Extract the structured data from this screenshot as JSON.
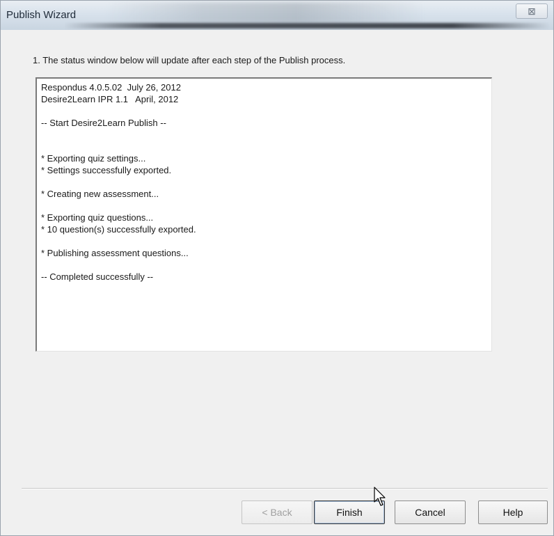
{
  "window": {
    "title": "Publish Wizard",
    "close_glyph": "⊠"
  },
  "instruction": "1.  The status window below will update after each step of the Publish process.",
  "status_lines": [
    "Respondus 4.0.5.02  July 26, 2012",
    "Desire2Learn IPR 1.1   April, 2012",
    "",
    "-- Start Desire2Learn Publish --",
    "",
    "",
    "* Exporting quiz settings...",
    "* Settings successfully exported.",
    "",
    "* Creating new assessment...",
    "",
    "* Exporting quiz questions...",
    "* 10 question(s) successfully exported.",
    "",
    "* Publishing assessment questions...",
    "",
    "-- Completed successfully --"
  ],
  "buttons": {
    "back": "< Back",
    "finish": "Finish",
    "cancel": "Cancel",
    "help": "Help"
  },
  "icons": {
    "close": "close-icon",
    "cursor": "mouse-pointer-icon"
  },
  "colors": {
    "title_text": "#1e2a38",
    "client_bg": "#f0f0f0",
    "status_bg": "#ffffff"
  }
}
